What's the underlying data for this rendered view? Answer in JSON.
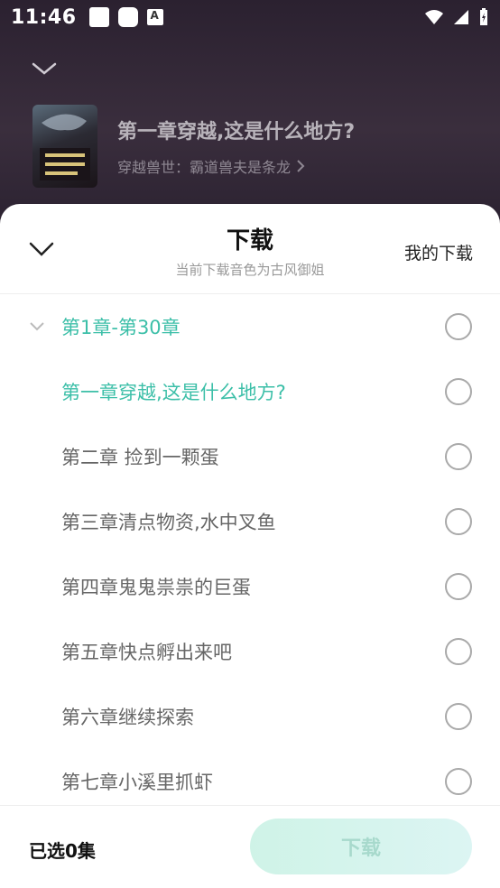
{
  "status_bar": {
    "time": "11:46",
    "icons": [
      "notification-square-icon",
      "notification-rounded-icon",
      "keyboard-a-icon",
      "wifi-icon",
      "cell-signal-icon",
      "battery-charging-icon"
    ]
  },
  "now_playing": {
    "title": "第一章穿越,这是什么地方?",
    "book": "穿越兽世：霸道兽夫是条龙"
  },
  "sheet": {
    "title": "下载",
    "subtitle": "当前下载音色为古风御姐",
    "my_downloads": "我的下载"
  },
  "chapters": [
    {
      "label": "第1章-第30章",
      "active": true,
      "group": true
    },
    {
      "label": "第一章穿越,这是什么地方?",
      "active": true
    },
    {
      "label": "第二章 捡到一颗蛋",
      "active": false
    },
    {
      "label": "第三章清点物资,水中叉鱼",
      "active": false
    },
    {
      "label": "第四章鬼鬼祟祟的巨蛋",
      "active": false
    },
    {
      "label": "第五章快点孵出来吧",
      "active": false
    },
    {
      "label": "第六章继续探索",
      "active": false
    },
    {
      "label": "第七章小溪里抓虾",
      "active": false
    }
  ],
  "footer": {
    "selected": "已选0集",
    "download_button": "下载"
  },
  "colors": {
    "accent": "#3cbfa8",
    "button_bg": "#cff3e7",
    "button_text": "#a7d9cc"
  }
}
